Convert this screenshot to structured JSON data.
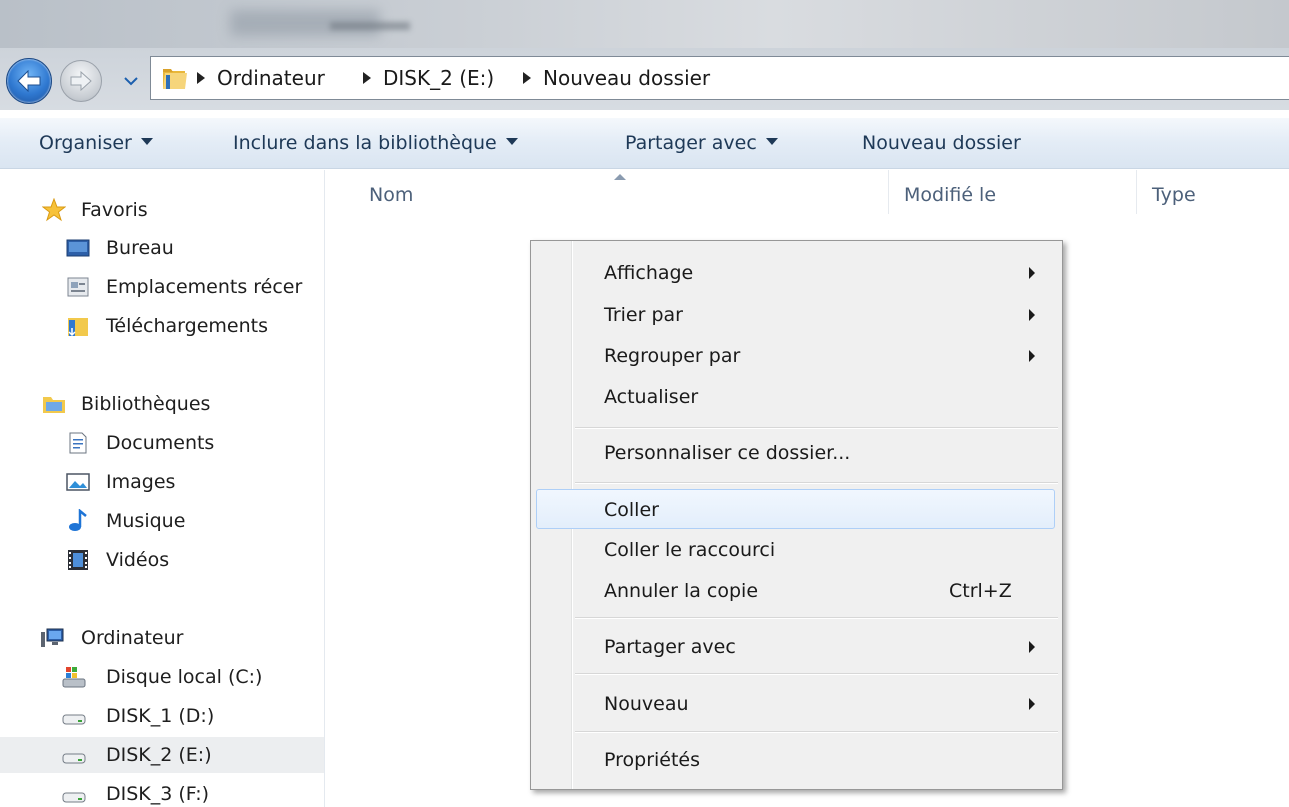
{
  "breadcrumb": [
    "Ordinateur",
    "DISK_2 (E:)",
    "Nouveau dossier"
  ],
  "toolbar": {
    "organize": "Organiser",
    "include_library": "Inclure dans la bibliothèque",
    "share_with": "Partager avec",
    "new_folder": "Nouveau dossier"
  },
  "columns": {
    "name": "Nom",
    "modified": "Modifié le",
    "type": "Type"
  },
  "sidebar": {
    "favorites": {
      "label": "Favoris",
      "items": [
        {
          "label": "Bureau",
          "icon": "desktop-icon"
        },
        {
          "label": "Emplacements récer",
          "icon": "recent-places-icon"
        },
        {
          "label": "Téléchargements",
          "icon": "downloads-icon"
        }
      ]
    },
    "libraries": {
      "label": "Bibliothèques",
      "items": [
        {
          "label": "Documents",
          "icon": "documents-icon"
        },
        {
          "label": "Images",
          "icon": "images-icon"
        },
        {
          "label": "Musique",
          "icon": "music-icon"
        },
        {
          "label": "Vidéos",
          "icon": "videos-icon"
        }
      ]
    },
    "computer": {
      "label": "Ordinateur",
      "items": [
        {
          "label": "Disque local (C:)",
          "icon": "system-drive-icon"
        },
        {
          "label": "DISK_1 (D:)",
          "icon": "drive-icon"
        },
        {
          "label": "DISK_2 (E:)",
          "icon": "drive-icon",
          "selected": true
        },
        {
          "label": "DISK_3 (F:)",
          "icon": "drive-icon"
        }
      ]
    }
  },
  "context_menu": {
    "items": [
      {
        "label": "Affichage",
        "submenu": true
      },
      {
        "label": "Trier par",
        "submenu": true
      },
      {
        "label": "Regrouper par",
        "submenu": true
      },
      {
        "label": "Actualiser"
      },
      {
        "label": "Personnaliser ce dossier..."
      },
      {
        "label": "Coller",
        "highlighted": true
      },
      {
        "label": "Coller le raccourci"
      },
      {
        "label": "Annuler la copie",
        "shortcut": "Ctrl+Z"
      },
      {
        "label": "Partager avec",
        "submenu": true
      },
      {
        "label": "Nouveau",
        "submenu": true
      },
      {
        "label": "Propriétés"
      }
    ]
  },
  "colors": {
    "accent": "#1e3957",
    "command_bar": "#e3ecf6",
    "menu_background": "#f0f0f0",
    "menu_highlight_border": "#aecff7",
    "folder_yellow": "#f2c94c"
  }
}
